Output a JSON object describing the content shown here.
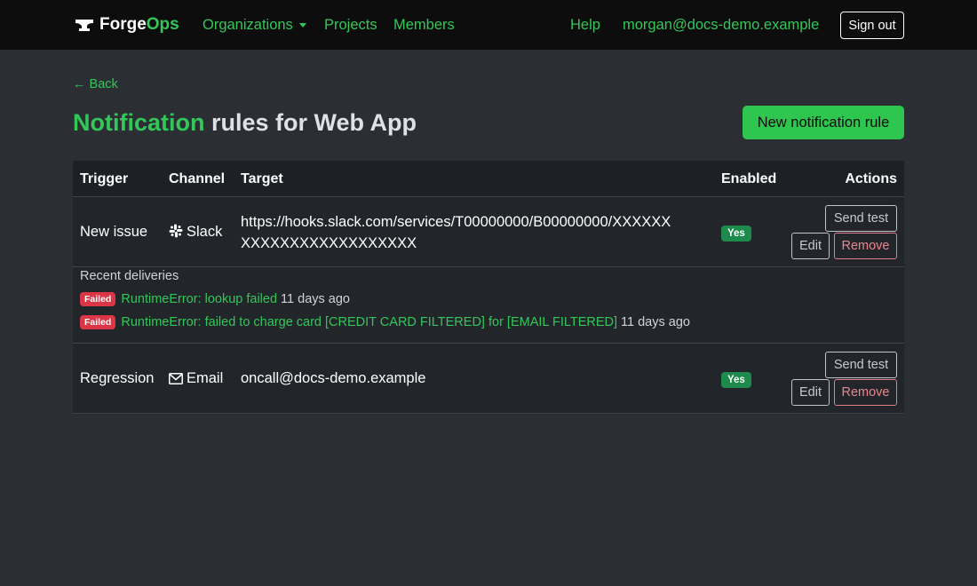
{
  "nav": {
    "brand_a": "Forge",
    "brand_b": "Ops",
    "organizations": "Organizations",
    "projects": "Projects",
    "members": "Members",
    "help": "Help",
    "user_email": "morgan@docs-demo.example",
    "sign_out": "Sign out"
  },
  "page": {
    "back": "← Back",
    "title_highlight": "Notification",
    "title_rest": " rules for Web App",
    "new_rule_button": "New notification rule"
  },
  "table": {
    "headers": [
      "Trigger",
      "Channel",
      "Target",
      "Enabled",
      "Actions"
    ],
    "rows": [
      {
        "trigger": "New issue",
        "channel": "Slack",
        "channel_icon": "slack-icon",
        "target_line1": "https://hooks.slack.com/services/T00000000/B00000000/XXXXXX",
        "target_line2": "XXXXXXXXXXXXXXXXXX",
        "enabled": "Yes",
        "send_test": "Send test",
        "edit": "Edit",
        "remove": "Remove"
      },
      {
        "trigger": "Regression",
        "channel": "Email",
        "channel_icon": "envelope-icon",
        "target_line1": "oncall@docs-demo.example",
        "enabled": "Yes",
        "send_test": "Send test",
        "edit": "Edit",
        "remove": "Remove"
      }
    ]
  },
  "deliveries": {
    "title": "Recent deliveries",
    "items": [
      {
        "status": "Failed",
        "message": "RuntimeError: lookup failed",
        "time": "11 days ago"
      },
      {
        "status": "Failed",
        "message": "RuntimeError: failed to charge card [CREDIT CARD FILTERED] for [EMAIL FILTERED]",
        "time": "11 days ago"
      }
    ]
  },
  "colors": {
    "accent": "#33c75a",
    "navbar": "#0d0d0d",
    "background": "#2b2e33",
    "danger": "#dc3545",
    "success_badge": "#1e8b4d"
  }
}
